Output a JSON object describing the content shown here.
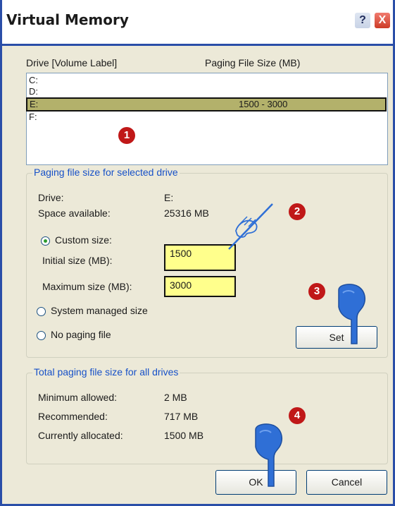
{
  "window": {
    "title": "Virtual Memory",
    "help_label": "?",
    "close_label": "X"
  },
  "drive_list": {
    "col_drive": "Drive  [Volume Label]",
    "col_size": "Paging File Size (MB)",
    "rows": [
      {
        "drive": "C:",
        "size": ""
      },
      {
        "drive": "D:",
        "size": ""
      },
      {
        "drive": "E:",
        "size": "1500 - 3000"
      },
      {
        "drive": "F:",
        "size": ""
      }
    ],
    "selected_index": 2
  },
  "selected_drive": {
    "group_title": "Paging file size for selected drive",
    "drive_label": "Drive:",
    "drive_value": "E:",
    "space_label": "Space available:",
    "space_value": "25316 MB",
    "custom_label": "Custom size:",
    "initial_label": "Initial size (MB):",
    "initial_value": "1500",
    "max_label": "Maximum size (MB):",
    "max_value": "3000",
    "system_label": "System managed size",
    "none_label": "No paging file",
    "set_label": "Set",
    "selected_option": "custom"
  },
  "totals": {
    "group_title": "Total paging file size for all drives",
    "min_label": "Minimum allowed:",
    "min_value": "2 MB",
    "rec_label": "Recommended:",
    "rec_value": "717 MB",
    "cur_label": "Currently allocated:",
    "cur_value": "1500 MB"
  },
  "footer": {
    "ok_label": "OK",
    "cancel_label": "Cancel"
  },
  "badges": [
    "1",
    "2",
    "3",
    "4"
  ],
  "colors": {
    "frame": "#2a4ea8",
    "dialog_bg": "#ece9d8",
    "group_title": "#1751c8",
    "highlight_row": "#b3b16b",
    "field_highlight": "#ffff8c",
    "badge": "#c01818",
    "hand": "#2f6fd6"
  },
  "icons": [
    "help-icon",
    "close-icon",
    "pen-hand-icon",
    "pointing-hand-icon"
  ]
}
